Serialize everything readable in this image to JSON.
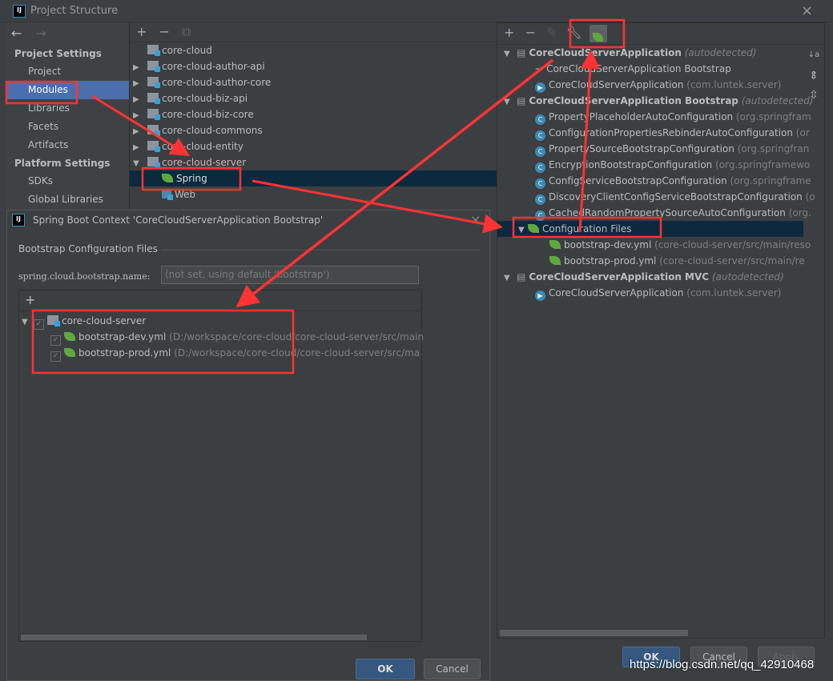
{
  "window": {
    "title": "Project Structure",
    "close": "×"
  },
  "nav": {
    "back": "←",
    "forward": "→"
  },
  "sidebar": {
    "project_settings": "Project Settings",
    "items1": [
      "Project",
      "Modules",
      "Libraries",
      "Facets",
      "Artifacts"
    ],
    "platform_settings": "Platform Settings",
    "items2": [
      "SDKs",
      "Global Libraries"
    ],
    "selected": "Modules"
  },
  "module_toolbar": {
    "add": "+",
    "remove": "−",
    "copy": "⧉"
  },
  "modules": [
    "core-cloud",
    "core-cloud-author-api",
    "core-cloud-author-core",
    "core-cloud-biz-api",
    "core-cloud-biz-core",
    "core-cloud-commons",
    "core-cloud-entity",
    "core-cloud-server"
  ],
  "server_children": [
    "Spring",
    "Web"
  ],
  "modal": {
    "title": "Spring Boot Context 'CoreCloudServerApplication Bootstrap'",
    "close": "×",
    "section": "Bootstrap Configuration Files",
    "field_label": "spring.cloud.bootstrap.name:",
    "field_placeholder": "(not set, using default 'bootstrap')",
    "add": "+",
    "tree": {
      "root": "core-cloud-server",
      "files": [
        {
          "name": "bootstrap-dev.yml",
          "path": "(D:/workspace/core-cloud/core-cloud-server/src/main"
        },
        {
          "name": "bootstrap-prod.yml",
          "path": "(D:/workspace/core-cloud/core-cloud-server/src/ma"
        }
      ]
    },
    "ok": "OK",
    "cancel": "Cancel"
  },
  "right": {
    "toolbar": {
      "add": "+",
      "remove": "−"
    },
    "rows": [
      {
        "text": "CoreCloudServerApplication",
        "suffix": "(autodetected)",
        "kind": "ctx"
      },
      {
        "text": "CoreCloudServerApplication Bootstrap",
        "suffix": "",
        "kind": "arrow"
      },
      {
        "text": "CoreCloudServerApplication",
        "suffix": "(com.luntek.server)",
        "kind": "app"
      },
      {
        "text": "CoreCloudServerApplication Bootstrap",
        "suffix": "(autodetected)",
        "kind": "ctx"
      },
      {
        "text": "PropertyPlaceholderAutoConfiguration",
        "suffix": "(org.springfram",
        "kind": "cls"
      },
      {
        "text": "ConfigurationPropertiesRebinderAutoConfiguration",
        "suffix": "(or",
        "kind": "cls"
      },
      {
        "text": "PropertySourceBootstrapConfiguration",
        "suffix": "(org.springfran",
        "kind": "cls"
      },
      {
        "text": "EncryptionBootstrapConfiguration",
        "suffix": "(org.springframewo",
        "kind": "cls"
      },
      {
        "text": "ConfigServiceBootstrapConfiguration",
        "suffix": "(org.springframe",
        "kind": "cls"
      },
      {
        "text": "DiscoveryClientConfigServiceBootstrapConfiguration",
        "suffix": "(o",
        "kind": "cls"
      },
      {
        "text": "CachedRandomPropertySourceAutoConfiguration",
        "suffix": "(org.",
        "kind": "cls"
      },
      {
        "text": "Configuration Files",
        "suffix": "",
        "kind": "cfg"
      },
      {
        "text": "bootstrap-dev.yml",
        "suffix": "(core-cloud-server/src/main/reso",
        "kind": "yml"
      },
      {
        "text": "bootstrap-prod.yml",
        "suffix": "(core-cloud-server/src/main/re",
        "kind": "yml"
      },
      {
        "text": "CoreCloudServerApplication MVC",
        "suffix": "(autodetected)",
        "kind": "ctx"
      },
      {
        "text": "CoreCloudServerApplication",
        "suffix": "(com.luntek.server)",
        "kind": "app"
      }
    ],
    "side_icons": {
      "sort": "↓a z",
      "expand": "⇕",
      "collapse": "⇳"
    }
  },
  "buttons": {
    "ok": "OK",
    "cancel": "Cancel",
    "apply": "Apply"
  },
  "watermark": "https://blog.csdn.net/qq_42910468",
  "colors": {
    "selection": "#0d293e",
    "sidebar_selected": "#4b6eaf",
    "annotation": "#ff3333"
  }
}
